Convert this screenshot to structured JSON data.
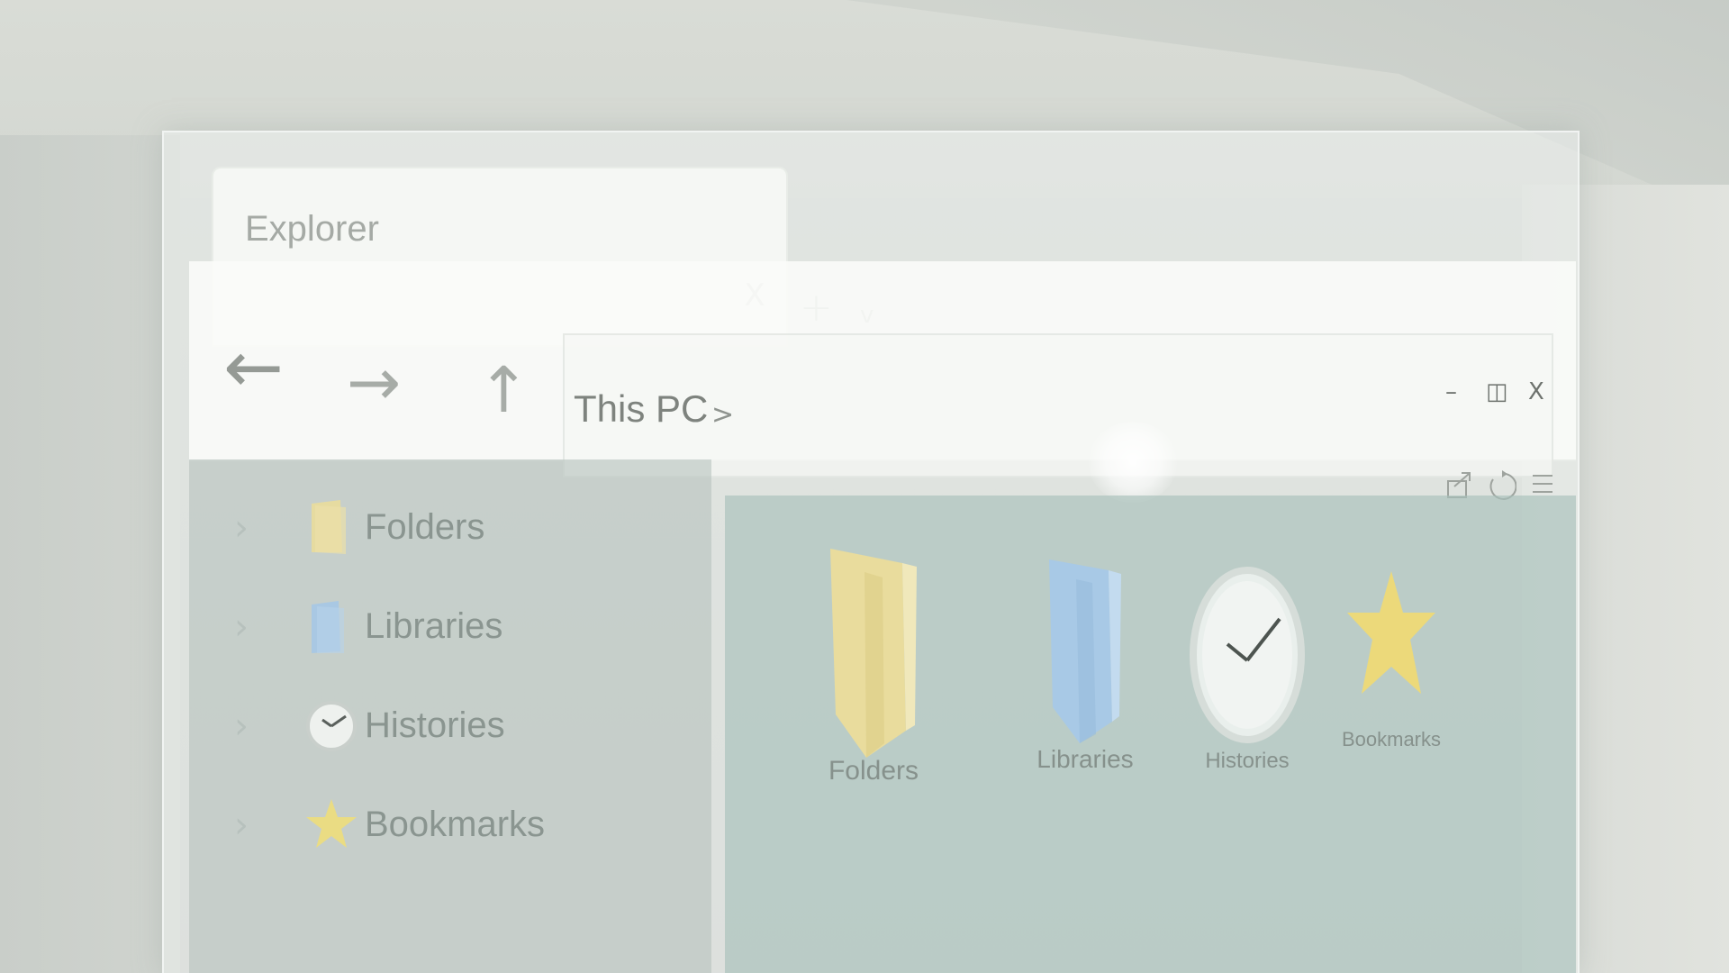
{
  "window": {
    "tab_title": "Explorer",
    "tab_close": "X",
    "new_tab": "+",
    "tab_dropdown": "v"
  },
  "nav": {
    "back": "←",
    "forward": "→",
    "up": "↑"
  },
  "address": {
    "path": "This PC",
    "chevron": ">"
  },
  "window_controls": {
    "minimize": "–",
    "maximize": "◫",
    "close": "X"
  },
  "toolbar": {
    "share_icon": "share-icon",
    "refresh_icon": "refresh-icon",
    "menu_icon": "menu-icon"
  },
  "sidebar": {
    "items": [
      {
        "label": "Folders",
        "icon": "folder-icon",
        "color": "#e6dba0"
      },
      {
        "label": "Libraries",
        "icon": "library-icon",
        "color": "#a9c8e3"
      },
      {
        "label": "Histories",
        "icon": "clock-icon",
        "color": "#eef1ee"
      },
      {
        "label": "Bookmarks",
        "icon": "star-icon",
        "color": "#eadc83"
      }
    ]
  },
  "content": {
    "items": [
      {
        "label": "Folders",
        "icon": "folder-icon"
      },
      {
        "label": "Libraries",
        "icon": "library-icon"
      },
      {
        "label": "Histories",
        "icon": "clock-icon"
      },
      {
        "label": "Bookmarks",
        "icon": "star-icon"
      }
    ]
  },
  "colors": {
    "folder": "#e9dc9d",
    "library": "#a8c9e6",
    "star": "#ecd97a",
    "pane": "#a8c0ba"
  }
}
